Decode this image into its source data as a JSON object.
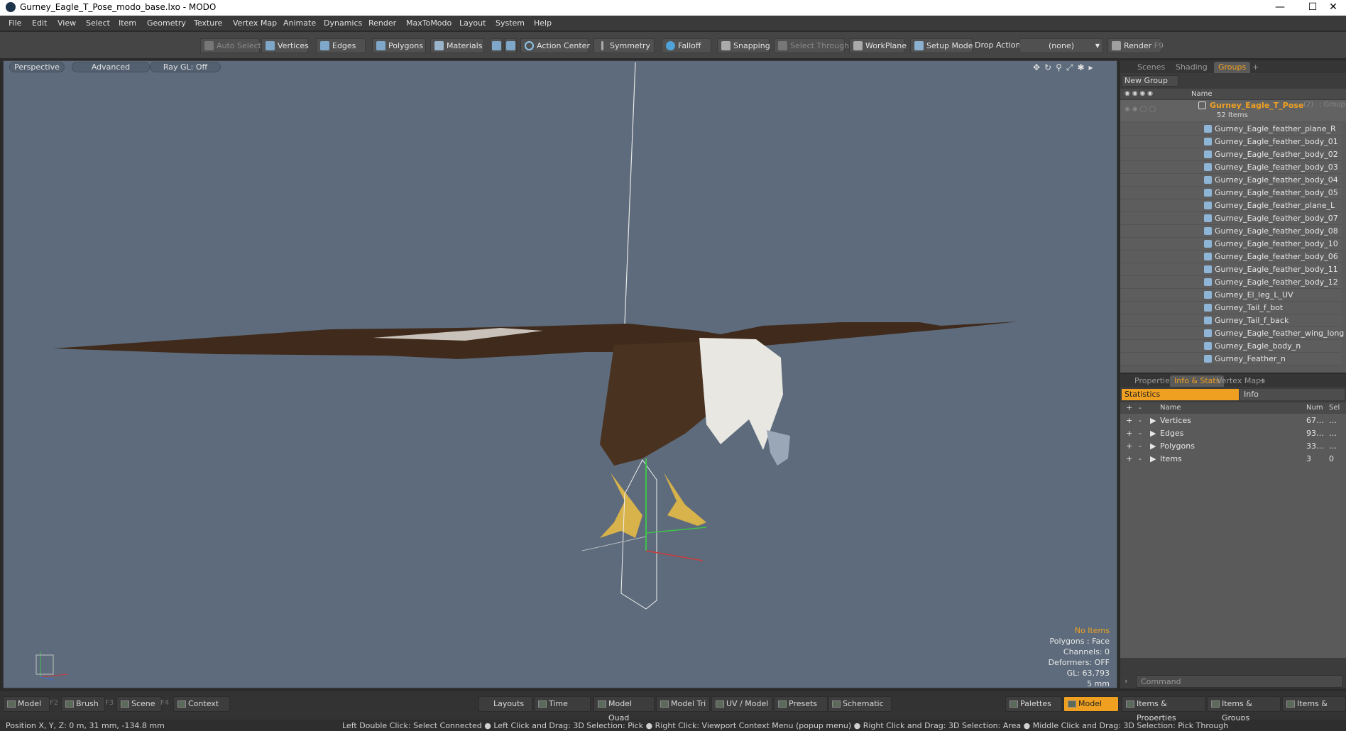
{
  "window": {
    "title": "Gurney_Eagle_T_Pose_modo_base.lxo - MODO",
    "minimize": "—",
    "maximize": "☐",
    "close": "✕"
  },
  "menu": [
    "File",
    "Edit",
    "View",
    "Select",
    "Item",
    "Geometry",
    "Texture",
    "Vertex Map",
    "Animate",
    "Dynamics",
    "Render",
    "MaxToModo",
    "Layout",
    "System",
    "Help"
  ],
  "toolbar": {
    "auto_select": "Auto Select",
    "vertices": "Vertices",
    "edges": "Edges",
    "polygons": "Polygons",
    "materials": "Materials",
    "action_center": "Action Center",
    "symmetry": "Symmetry",
    "falloff": "Falloff",
    "snapping": "Snapping",
    "select_through": "Select Through",
    "workplane": "WorkPlane",
    "setup_mode": "Setup Mode",
    "drop_action": "Drop Action",
    "drop_value": "(none)",
    "render": "Render",
    "render_key": "F9"
  },
  "viewport": {
    "perspective": "Perspective",
    "advanced": "Advanced",
    "raygl": "Ray GL: Off",
    "info": {
      "no_items": "No Items",
      "polygons": "Polygons : Face",
      "channels": "Channels: 0",
      "deformers": "Deformers: OFF",
      "gl": "GL: 63,793",
      "scale": "5 mm"
    }
  },
  "groups_panel": {
    "tabs": [
      "Scenes",
      "Shading",
      "Groups"
    ],
    "active_tab": "Groups",
    "new_group": "New Group",
    "col_name": "Name",
    "root": {
      "name": "Gurney_Eagle_T_Pose",
      "count": "(2)",
      "type": ": Group",
      "items": "52 Items"
    },
    "items": [
      "Gurney_Eagle_feather_plane_R",
      "Gurney_Eagle_feather_body_01",
      "Gurney_Eagle_feather_body_02",
      "Gurney_Eagle_feather_body_03",
      "Gurney_Eagle_feather_body_04",
      "Gurney_Eagle_feather_body_05",
      "Gurney_Eagle_feather_plane_L",
      "Gurney_Eagle_feather_body_07",
      "Gurney_Eagle_feather_body_08",
      "Gurney_Eagle_feather_body_10",
      "Gurney_Eagle_feather_body_06",
      "Gurney_Eagle_feather_body_11",
      "Gurney_Eagle_feather_body_12",
      "Gurney_El_leg_L_UV",
      "Gurney_Tail_f_bot",
      "Gurney_Tail_f_back",
      "Gurney_Eagle_feather_wing_long",
      "Gurney_Eagle_body_n",
      "Gurney_Feather_n"
    ]
  },
  "stats_panel": {
    "tabs": [
      "Properties",
      "Info & Stats",
      "Vertex Maps"
    ],
    "active_tab": "Info & Stats",
    "sub_tabs": [
      "Statistics",
      "Info"
    ],
    "cols": {
      "name": "Name",
      "num": "Num",
      "sel": "Sel"
    },
    "rows": [
      {
        "name": "Vertices",
        "num": "67…",
        "sel": "…"
      },
      {
        "name": "Edges",
        "num": "93…",
        "sel": "…"
      },
      {
        "name": "Polygons",
        "num": "33…",
        "sel": "…"
      },
      {
        "name": "Items",
        "num": "3",
        "sel": "0"
      }
    ],
    "command_placeholder": "Command"
  },
  "bottom": {
    "model": "Model",
    "model_key": "F2",
    "brush": "Brush",
    "brush_key": "F3",
    "scene": "Scene",
    "scene_key": "F4",
    "context": "Context",
    "layouts": "Layouts",
    "time": "Time",
    "model_quad": "Model Quad",
    "model_tri": "Model Tri",
    "uv_model": "UV / Model",
    "presets": "Presets",
    "schematic": "Schematic",
    "palettes": "Palettes",
    "model_active": "Model",
    "items_props": "Items & Properties",
    "items_groups": "Items & Groups",
    "items_shading": "Items & Shadi"
  },
  "status": {
    "position": "Position X, Y, Z:   0 m, 31 mm, -134.8 mm",
    "hints": "Left Double Click: Select Connected ● Left Click and Drag: 3D Selection: Pick ● Right Click: Viewport Context Menu (popup menu) ● Right Click and Drag: 3D Selection: Area ● Middle Click and Drag: 3D Selection: Pick Through"
  },
  "colors": {
    "viewport_bg": "#5d6b7c",
    "accent": "#f0a020"
  }
}
